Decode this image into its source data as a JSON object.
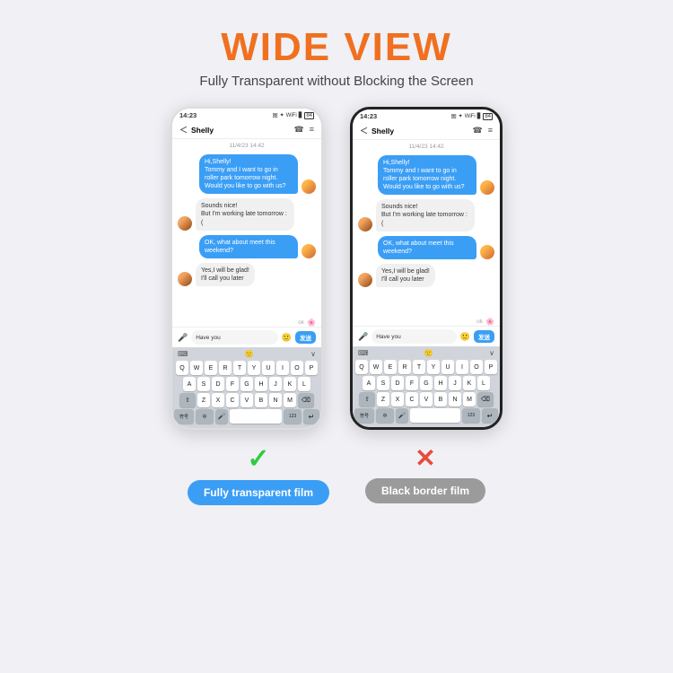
{
  "header": {
    "title": "WIDE VIEW",
    "subtitle": "Fully Transparent without Blocking the Screen"
  },
  "phone_left": {
    "type": "white",
    "status_time": "14:23",
    "contact": "Shelly",
    "date_sep": "11/4/23 14:42",
    "messages": [
      {
        "type": "sent",
        "text": "Hi,Shelly!\nTommy and I want to go in roller park tomorrow night. Would you like to go with us?"
      },
      {
        "type": "recv",
        "text": "Sounds nice!\nBut I'm working late tomorrow :("
      },
      {
        "type": "sent",
        "text": "OK, what about meet this weekend?"
      },
      {
        "type": "recv",
        "text": "Yes,I will be glad!\nI'll call you later"
      }
    ],
    "ok_text": "ok",
    "input_text": "Have you",
    "send_label": "发送",
    "keyboard_rows": [
      [
        "Q",
        "W",
        "E",
        "R",
        "T",
        "Y",
        "U",
        "I",
        "O",
        "P"
      ],
      [
        "A",
        "S",
        "D",
        "F",
        "G",
        "H",
        "J",
        "K",
        "L"
      ],
      [
        "Z",
        "X",
        "C",
        "V",
        "B",
        "N",
        "M"
      ]
    ],
    "kb_bottom": [
      "符号",
      "中₃",
      "⬆",
      "123",
      "↵"
    ]
  },
  "phone_right": {
    "type": "black",
    "status_time": "14:23",
    "contact": "Shelly",
    "date_sep": "11/4/23 14:42",
    "messages": [
      {
        "type": "sent",
        "text": "Hi,Shelly!\nTommy and I want to go in roller park tomorrow night. Would you like to go with us?"
      },
      {
        "type": "recv",
        "text": "Sounds nice!\nBut I'm working late tomorrow :("
      },
      {
        "type": "sent",
        "text": "OK, what about meet this weekend?"
      },
      {
        "type": "recv",
        "text": "Yes,I will be glad!\nI'll call you later"
      }
    ],
    "ok_text": "ok",
    "input_text": "Have you",
    "send_label": "发送"
  },
  "label_left": {
    "symbol": "✓",
    "text": "Fully transparent film"
  },
  "label_right": {
    "symbol": "✕",
    "text": "Black border film"
  }
}
